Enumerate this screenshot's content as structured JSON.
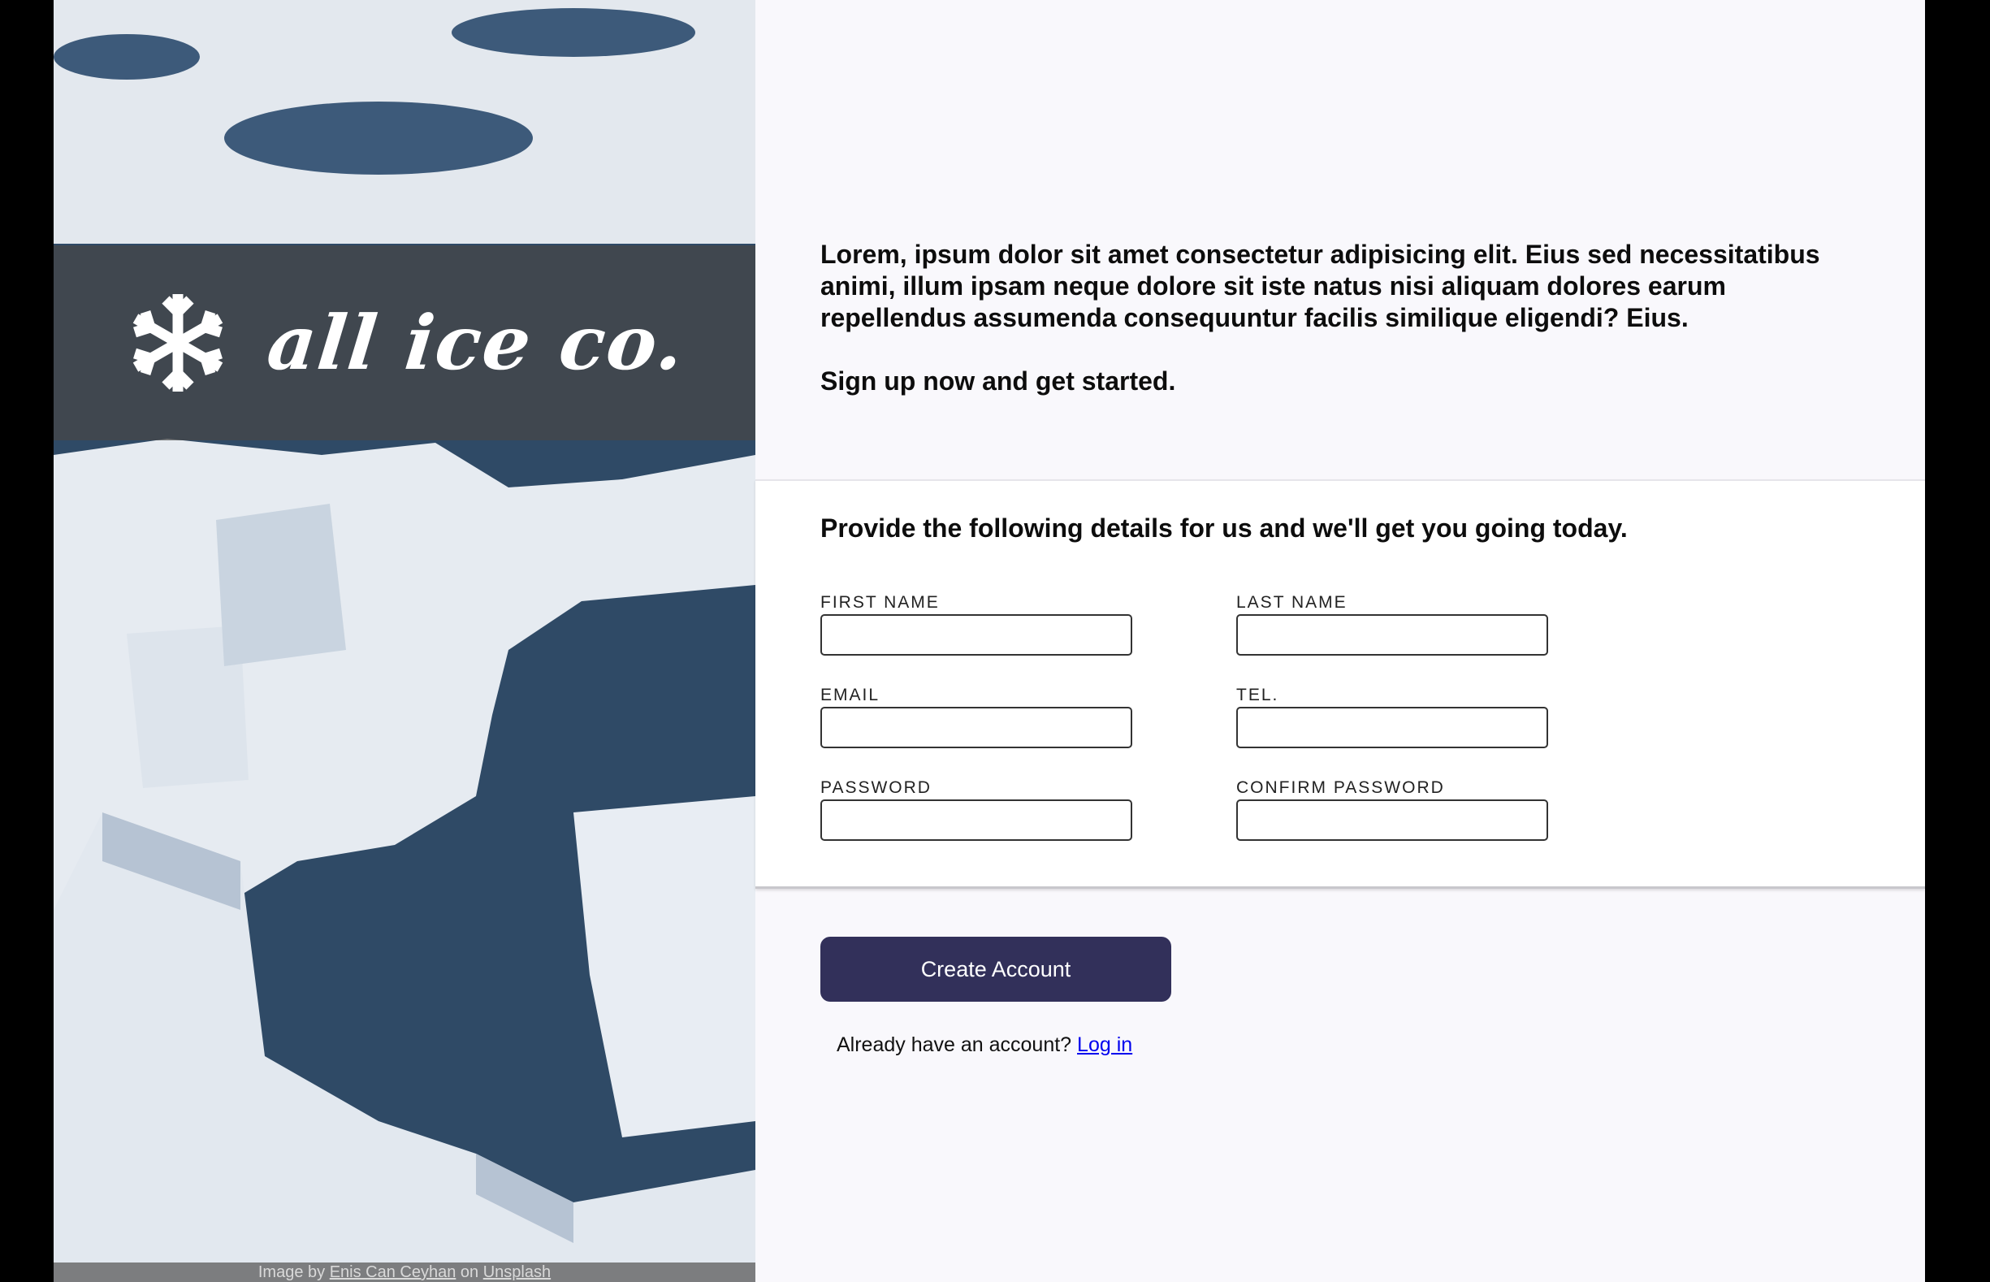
{
  "brand": {
    "name": "all ice co.",
    "icon": "snowflake-icon"
  },
  "credit": {
    "prefix": "Image by",
    "author": "Enis Can Ceyhan",
    "middle": "on",
    "site": "Unsplash"
  },
  "intro": {
    "paragraph": "Lorem, ipsum dolor sit amet consectetur adipisicing elit. Eius sed necessitatibus animi, illum ipsam neque dolore sit iste natus nisi aliquam dolores earum repellendus assumenda consequuntur facilis similique eligendi? Eius.",
    "cta": "Sign up now and get started."
  },
  "form": {
    "heading": "Provide the following details for us and we'll get you going today.",
    "fields": {
      "first_name": {
        "label": "FIRST NAME",
        "value": ""
      },
      "last_name": {
        "label": "LAST NAME",
        "value": ""
      },
      "email": {
        "label": "EMAIL",
        "value": ""
      },
      "tel": {
        "label": "TEL.",
        "value": ""
      },
      "password": {
        "label": "PASSWORD",
        "value": ""
      },
      "confirm_password": {
        "label": "CONFIRM PASSWORD",
        "value": ""
      }
    }
  },
  "actions": {
    "create_label": "Create Account",
    "login_prompt": "Already have an account?",
    "login_link": "Log in"
  },
  "colors": {
    "button_bg": "#32305a",
    "content_bg": "#f9f8fc",
    "link": "#0000ee"
  }
}
